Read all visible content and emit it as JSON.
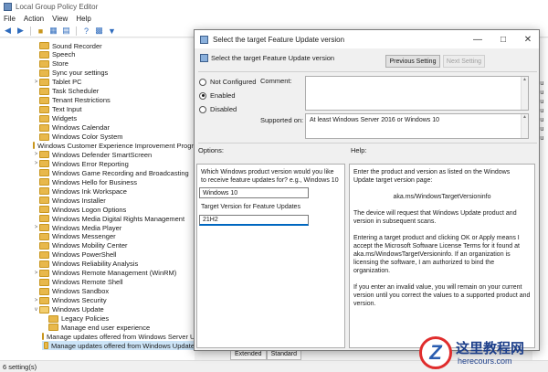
{
  "main_window": {
    "title": "Local Group Policy Editor",
    "menu": [
      "File",
      "Action",
      "View",
      "Help"
    ],
    "status": "6 setting(s)",
    "tabs": [
      "Extended",
      "Standard"
    ],
    "right_column": [
      "figu",
      "figu",
      "figu",
      "figu",
      "figu",
      "figu",
      "figu"
    ]
  },
  "tree": {
    "items": [
      {
        "label": "Sound Recorder",
        "expand": ""
      },
      {
        "label": "Speech",
        "expand": ""
      },
      {
        "label": "Store",
        "expand": ""
      },
      {
        "label": "Sync your settings",
        "expand": ""
      },
      {
        "label": "Tablet PC",
        "expand": ">"
      },
      {
        "label": "Task Scheduler",
        "expand": ""
      },
      {
        "label": "Tenant Restrictions",
        "expand": ""
      },
      {
        "label": "Text Input",
        "expand": ""
      },
      {
        "label": "Widgets",
        "expand": ""
      },
      {
        "label": "Windows Calendar",
        "expand": ""
      },
      {
        "label": "Windows Color System",
        "expand": ""
      },
      {
        "label": "Windows Customer Experience Improvement Program",
        "expand": ""
      },
      {
        "label": "Windows Defender SmartScreen",
        "expand": ">"
      },
      {
        "label": "Windows Error Reporting",
        "expand": ">"
      },
      {
        "label": "Windows Game Recording and Broadcasting",
        "expand": ""
      },
      {
        "label": "Windows Hello for Business",
        "expand": ""
      },
      {
        "label": "Windows Ink Workspace",
        "expand": ""
      },
      {
        "label": "Windows Installer",
        "expand": ""
      },
      {
        "label": "Windows Logon Options",
        "expand": ""
      },
      {
        "label": "Windows Media Digital Rights Management",
        "expand": ""
      },
      {
        "label": "Windows Media Player",
        "expand": ">"
      },
      {
        "label": "Windows Messenger",
        "expand": ""
      },
      {
        "label": "Windows Mobility Center",
        "expand": ""
      },
      {
        "label": "Windows PowerShell",
        "expand": ""
      },
      {
        "label": "Windows Reliability Analysis",
        "expand": ""
      },
      {
        "label": "Windows Remote Management (WinRM)",
        "expand": ">"
      },
      {
        "label": "Windows Remote Shell",
        "expand": ""
      },
      {
        "label": "Windows Sandbox",
        "expand": ""
      },
      {
        "label": "Windows Security",
        "expand": ">"
      },
      {
        "label": "Windows Update",
        "expand": "v"
      },
      {
        "label": "Legacy Policies",
        "expand": ""
      },
      {
        "label": "Manage end user experience",
        "expand": ""
      },
      {
        "label": "Manage updates offered from Windows Server Update",
        "expand": ""
      },
      {
        "label": "Manage updates offered from Windows Update",
        "expand": ""
      }
    ]
  },
  "dialog": {
    "title": "Select the target Feature Update version",
    "header": "Select the target Feature Update version",
    "prev_label": "Previous Setting",
    "next_label": "Next Setting",
    "radio_not_configured": "Not Configured",
    "radio_enabled": "Enabled",
    "radio_disabled": "Disabled",
    "comment_label": "Comment:",
    "supported_label": "Supported on:",
    "supported_value": "At least Windows Server 2016 or Windows 10",
    "options_label": "Options:",
    "help_label": "Help:",
    "option_prompt": "Which Windows product version would you like to receive feature updates for? e.g., Windows 10",
    "product_value": "Windows 10",
    "target_label": "Target Version for Feature Updates",
    "target_value": "21H2",
    "help": [
      "Enter the product and version as listed on the Windows Update target version page:",
      "aka.ms/WindowsTargetVersioninfo",
      "The device will request that Windows Update product and version in subsequent scans.",
      "Entering a target product and clicking OK or Apply means I accept the Microsoft Software License Terms for it found at aka.ms/WindowsTargetVersioninfo. If an organization is licensing the software, I am authorized to bind the organization.",
      "If you enter an invalid value, you will remain on your current version until you correct the values to a supported product and version."
    ]
  },
  "watermark": {
    "logo_letter": "Z",
    "text": "这里教程网",
    "url": "herecours.com"
  }
}
